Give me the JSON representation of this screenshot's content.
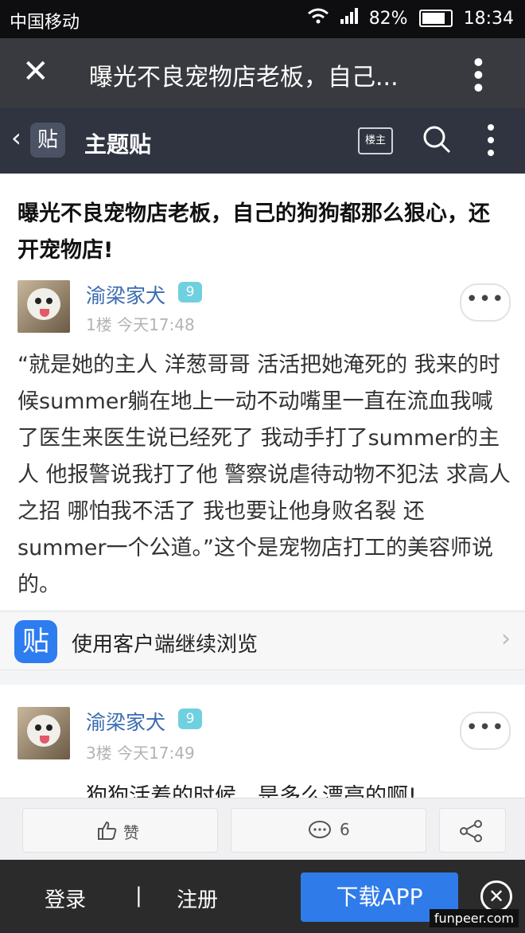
{
  "status": {
    "carrier": "中国移动",
    "battery": "82%",
    "time": "18:34"
  },
  "window": {
    "title": "曝光不良宠物店老板，自己..."
  },
  "topbar": {
    "back_logo": "贴",
    "title": "主题贴",
    "op_label": "楼主"
  },
  "post": {
    "title": "曝光不良宠物店老板，自己的狗狗都那么狠心，还开宠物店!",
    "author": "渝梁家犬",
    "level": "9",
    "meta": "1楼  今天17:48",
    "body": "“就是她的主人 洋葱哥哥 活活把她淹死的 我来的时候summer躺在地上一动不动嘴里一直在流血我喊了医生来医生说已经死了 我动手打了summer的主人 他报警说我打了他 警察说虐待动物不犯法 求高人之招 哪怕我不活了 我也要让他身败名裂 还summer一个公道。”这个是宠物店打工的美容师说的。"
  },
  "appbar": {
    "icon": "贴",
    "label": "使用客户端继续浏览"
  },
  "post2": {
    "author": "渝梁家犬",
    "level": "9",
    "meta": "3楼  今天17:49",
    "body": "狗狗活着的时候，是多么漂亮的啊!"
  },
  "actions": {
    "like_label": "赞",
    "comment_count": "6"
  },
  "bottom": {
    "login": "登录",
    "separator": "|",
    "register": "注册",
    "download": "下载APP"
  },
  "watermark": "funpeer.com"
}
